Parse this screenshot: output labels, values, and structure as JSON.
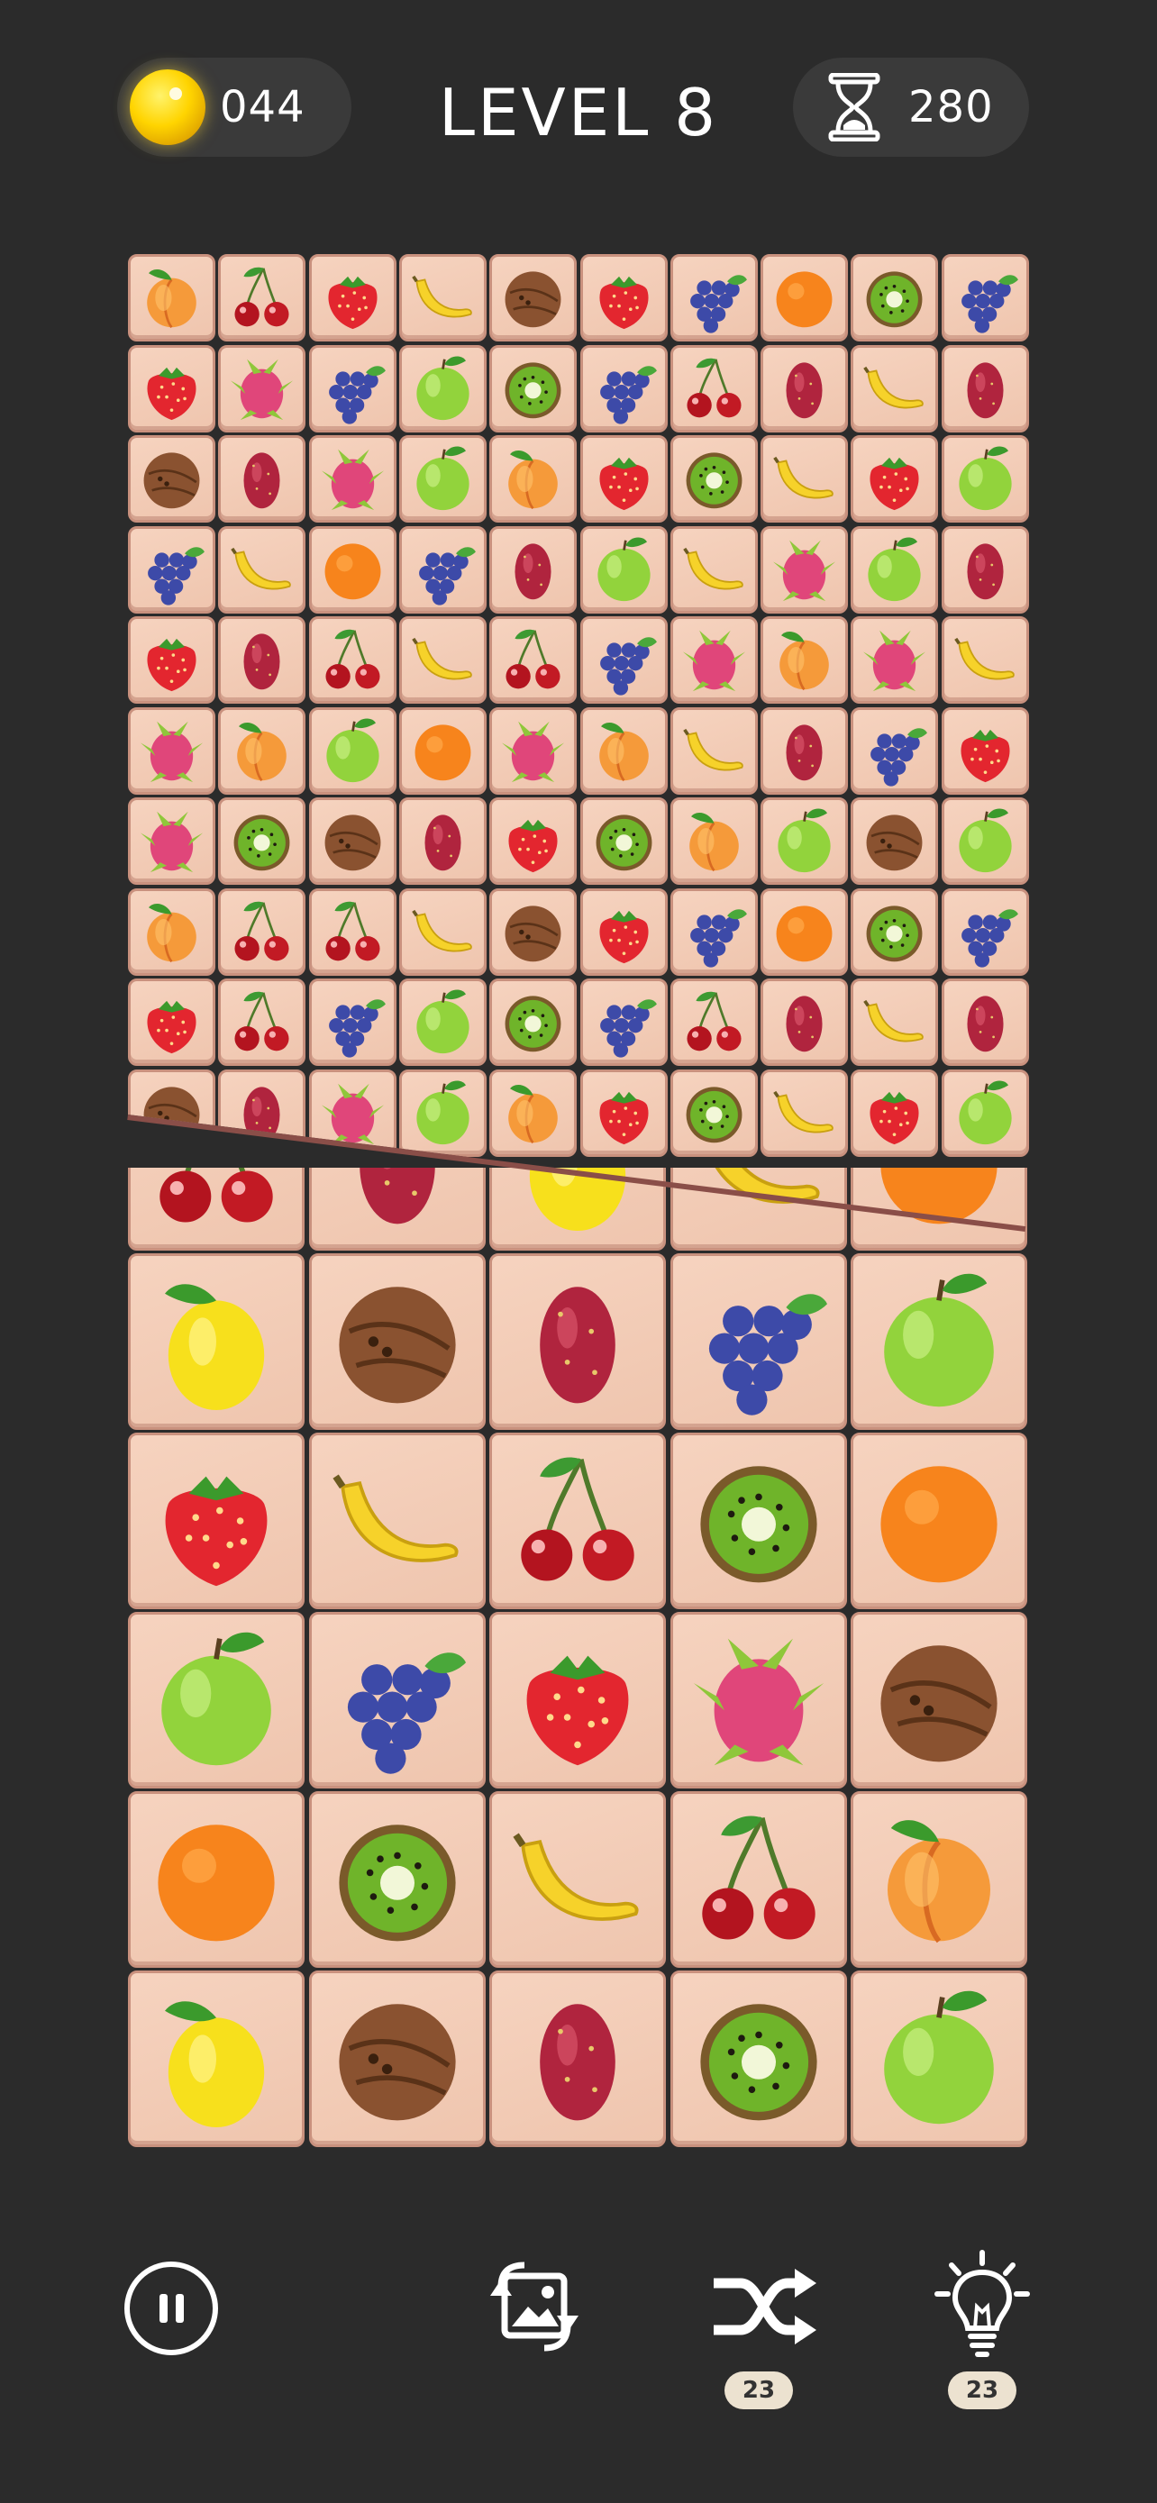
{
  "header": {
    "coins": "044",
    "level_title": "LEVEL 8",
    "timer": "280"
  },
  "colors": {
    "background": "#2b2b2b",
    "tile": "#f6d3bf",
    "tile_border": "#c9917e",
    "coin": "#ffd400"
  },
  "board": {
    "top_layer": [
      [
        "peach",
        "cherry",
        "strawberry",
        "banana",
        "coconut",
        "strawberry",
        "grapes",
        "orange",
        "kiwi",
        "grapes"
      ],
      [
        "strawberry",
        "dragonfruit",
        "grapes",
        "apple",
        "kiwi",
        "grapes",
        "cherry",
        "pricklypear",
        "banana",
        "pricklypear"
      ],
      [
        "coconut",
        "pricklypear",
        "dragonfruit",
        "apple",
        "peach",
        "strawberry",
        "kiwi",
        "banana",
        "strawberry",
        "apple"
      ],
      [
        "grapes",
        "banana",
        "orange",
        "grapes",
        "pricklypear",
        "apple",
        "banana",
        "dragonfruit",
        "apple",
        "pricklypear"
      ],
      [
        "strawberry",
        "pricklypear",
        "cherry",
        "banana",
        "cherry",
        "grapes",
        "dragonfruit",
        "peach",
        "dragonfruit",
        "banana"
      ],
      [
        "dragonfruit",
        "peach",
        "apple",
        "orange",
        "dragonfruit",
        "peach",
        "banana",
        "pricklypear",
        "grapes",
        "strawberry"
      ],
      [
        "dragonfruit",
        "kiwi",
        "coconut",
        "pricklypear",
        "strawberry",
        "kiwi",
        "peach",
        "apple",
        "coconut",
        "apple"
      ],
      [
        "peach",
        "cherry",
        "cherry",
        "banana",
        "coconut",
        "strawberry",
        "grapes",
        "orange",
        "kiwi",
        "grapes"
      ],
      [
        "strawberry",
        "cherry",
        "grapes",
        "apple",
        "kiwi",
        "grapes",
        "cherry",
        "pricklypear",
        "banana",
        "pricklypear"
      ],
      [
        "coconut",
        "pricklypear",
        "dragonfruit",
        "apple",
        "peach",
        "strawberry",
        "kiwi",
        "banana",
        "strawberry",
        "apple"
      ]
    ],
    "bottom_layer": [
      [
        "cherry",
        "pricklypear",
        "lemon",
        "banana",
        "orange"
      ],
      [
        "lemon",
        "coconut",
        "pricklypear",
        "grapes",
        "apple"
      ],
      [
        "strawberry",
        "banana",
        "cherry",
        "kiwi",
        "orange"
      ],
      [
        "apple",
        "grapes",
        "strawberry",
        "dragonfruit",
        "coconut"
      ],
      [
        "orange",
        "kiwi",
        "banana",
        "cherry",
        "peach"
      ],
      [
        "lemon",
        "coconut",
        "pricklypear",
        "kiwi",
        "apple"
      ]
    ]
  },
  "controls": {
    "pause_icon": "pause-icon",
    "picture_swap_icon": "picture-swap-icon",
    "shuffle_icon": "shuffle-icon",
    "shuffle_count": "23",
    "hint_icon": "lightbulb-icon",
    "hint_count": "23"
  }
}
